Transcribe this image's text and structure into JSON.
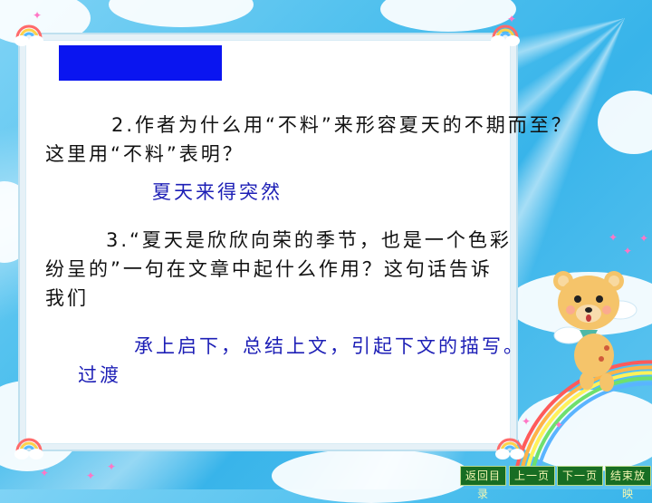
{
  "slide": {
    "question2_line1": "2.作者为什么用“不料”来形容夏天的不期而至？",
    "question2_line2": "这里用“不料”表明？",
    "answer2": "夏天来得突然",
    "question3_line1": "3.“夏天是欣欣向荣的季节，也是一个色彩",
    "question3_line2": "纷呈的”一句在文章中起什么作用？这句话告诉",
    "question3_line3": "我们",
    "answer3_line1": "承上启下，总结上文，引起下文的描写。",
    "answer3_line2": "过渡"
  },
  "nav": {
    "back_to_contents": "返回目录",
    "prev_page": "上一页",
    "next_page": "下一页",
    "end_lesson": "结束放映"
  },
  "colors": {
    "title_box": "#0a15f0",
    "answer_text": "#1d1fb6",
    "nav_bg": "#176d23"
  }
}
